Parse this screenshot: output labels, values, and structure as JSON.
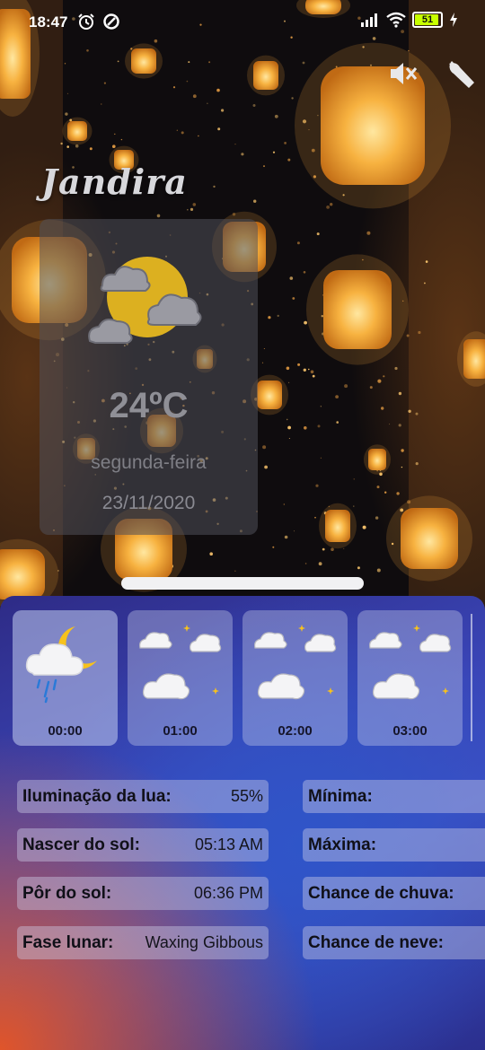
{
  "status_bar": {
    "time": "18:47",
    "battery": "51"
  },
  "location": {
    "city": "Jandira"
  },
  "current": {
    "temperature": "24ºC",
    "day": "segunda-feira",
    "date": "23/11/2020",
    "icon": "cloudy-sun-icon"
  },
  "hourly": [
    {
      "time": "00:00",
      "icon": "cloud-moon-rain-icon"
    },
    {
      "time": "01:00",
      "icon": "cloudy-night-icon"
    },
    {
      "time": "02:00",
      "icon": "cloudy-night-icon"
    },
    {
      "time": "03:00",
      "icon": "cloudy-night-icon"
    }
  ],
  "details_left": [
    {
      "label": "Iluminação da lua:",
      "value": "55%"
    },
    {
      "label": "Nascer do sol:",
      "value": "05:13 AM"
    },
    {
      "label": "Pôr do sol:",
      "value": "06:36 PM"
    },
    {
      "label": "Fase lunar:",
      "value": "Waxing Gibbous"
    }
  ],
  "details_right": [
    {
      "label": "Mínima:"
    },
    {
      "label": "Máxima:"
    },
    {
      "label": "Chance de chuva:"
    },
    {
      "label": "Chance de neve:"
    }
  ],
  "colors": {
    "lantern": "#f2a93b",
    "panel_blue": "#3a46b8",
    "panel_orange": "#e0552a",
    "moon": "#f7c21c"
  }
}
